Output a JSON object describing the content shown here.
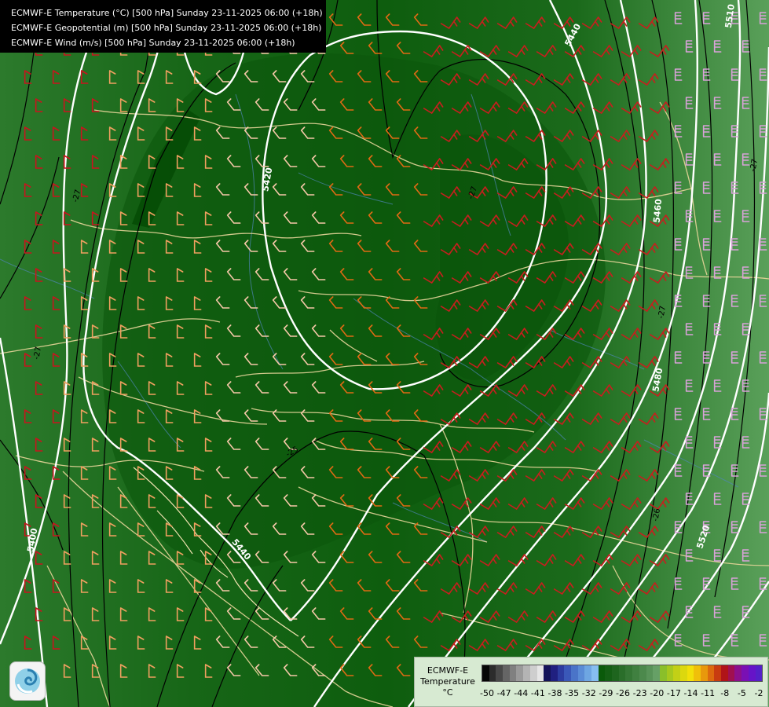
{
  "titles": [
    "ECMWF-E Temperature (°C) [500 hPa] Sunday 23-11-2025 06:00 (+18h)",
    "ECMWF-E Geopotential (m) [500 hPa] Sunday 23-11-2025 06:00 (+18h)",
    "ECMWF-E Wind (m/s) [500 hPa] Sunday 23-11-2025 06:00 (+18h)"
  ],
  "legend": {
    "model": "ECMWF-E",
    "variable": "Temperature",
    "unit": "°C",
    "ticks": [
      "-50",
      "-47",
      "-44",
      "-41",
      "-38",
      "-35",
      "-32",
      "-29",
      "-26",
      "-23",
      "-20",
      "-17",
      "-14",
      "-11",
      "-8",
      "-5",
      "-2"
    ],
    "colors": [
      "#060606",
      "#2c2c2c",
      "#484848",
      "#656565",
      "#808080",
      "#9a9a9a",
      "#b4b4b4",
      "#cecece",
      "#e6e6e6",
      "#14145a",
      "#202080",
      "#2c3ca0",
      "#3a58b8",
      "#4a74c8",
      "#5a8cd6",
      "#6ea6e2",
      "#86bef0",
      "#0a5a0a",
      "#145f14",
      "#1e651e",
      "#2a6e2a",
      "#357735",
      "#408040",
      "#4c894c",
      "#589358",
      "#66a066",
      "#8abf2a",
      "#a6c81e",
      "#c2d016",
      "#dcd80e",
      "#f2e00a",
      "#f0c00a",
      "#e8980c",
      "#dc6a0e",
      "#c83c10",
      "#b01418",
      "#a01050",
      "#8c108c",
      "#7a10b4",
      "#6614c8",
      "#5420c8"
    ]
  },
  "contour_labels": {
    "geopotential": [
      "5440",
      "5420",
      "5460",
      "5480",
      "5520",
      "5400",
      "5440",
      "5510"
    ],
    "temperature": [
      "-27",
      "-27",
      "-27",
      "-27",
      "-26",
      "-25",
      "-27"
    ]
  }
}
